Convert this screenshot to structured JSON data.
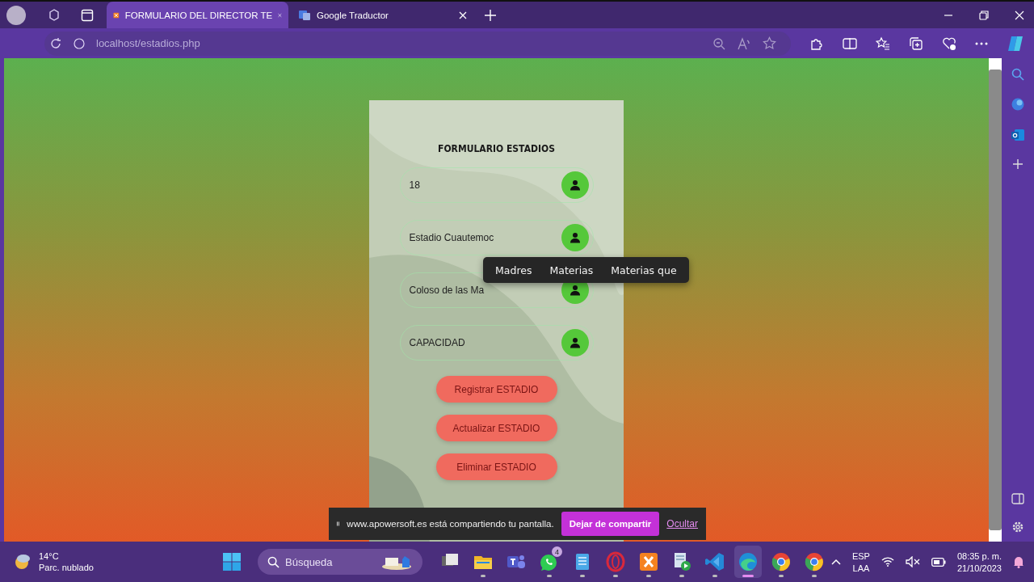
{
  "browser": {
    "tabs": [
      {
        "title": "FORMULARIO DEL DIRECTOR TE",
        "selected": true,
        "kind": "xampp"
      },
      {
        "title": "Google Traductor",
        "selected": false,
        "kind": "translate"
      }
    ],
    "address": "localhost/estadios.php"
  },
  "form": {
    "title": "FORMULARIO ESTADIOS",
    "fields": [
      {
        "value": "18"
      },
      {
        "value": "Estadio Cuautemoc"
      },
      {
        "value": "Coloso de las Ma"
      },
      {
        "placeholder": "CAPACIDAD"
      }
    ],
    "buttons": [
      "Registrar ESTADIO",
      "Actualizar ESTADIO",
      "Eliminar ESTADIO"
    ]
  },
  "popup": {
    "items": [
      "Madres",
      "Materias",
      "Materias que"
    ]
  },
  "share_bar": {
    "message": "www.apowersoft.es está compartiendo tu pantalla.",
    "stop_button": "Dejar de compartir",
    "hide_link": "Ocultar"
  },
  "taskbar": {
    "weather": {
      "temperature": "14°C",
      "condition": "Parc. nublado"
    },
    "search_placeholder": "Búsqueda",
    "apps": [
      {
        "kind": "task-view",
        "running": false,
        "selected": false
      },
      {
        "kind": "files",
        "running": true,
        "selected": false
      },
      {
        "kind": "teams",
        "running": false,
        "selected": false
      },
      {
        "kind": "whatsapp",
        "running": true,
        "selected": false,
        "badge": "4"
      },
      {
        "kind": "notepad",
        "running": true,
        "selected": false
      },
      {
        "kind": "opera",
        "running": true,
        "selected": false
      },
      {
        "kind": "xampp",
        "running": true,
        "selected": false
      },
      {
        "kind": "media",
        "running": true,
        "selected": false
      },
      {
        "kind": "vscode",
        "running": true,
        "selected": false
      },
      {
        "kind": "edge",
        "running": true,
        "selected": true
      },
      {
        "kind": "chrome",
        "running": true,
        "selected": false
      },
      {
        "kind": "chrome",
        "running": true,
        "selected": false
      }
    ],
    "language": [
      "ESP",
      "LAA"
    ],
    "time": "08:35 p. m.",
    "date": "21/10/2023"
  }
}
